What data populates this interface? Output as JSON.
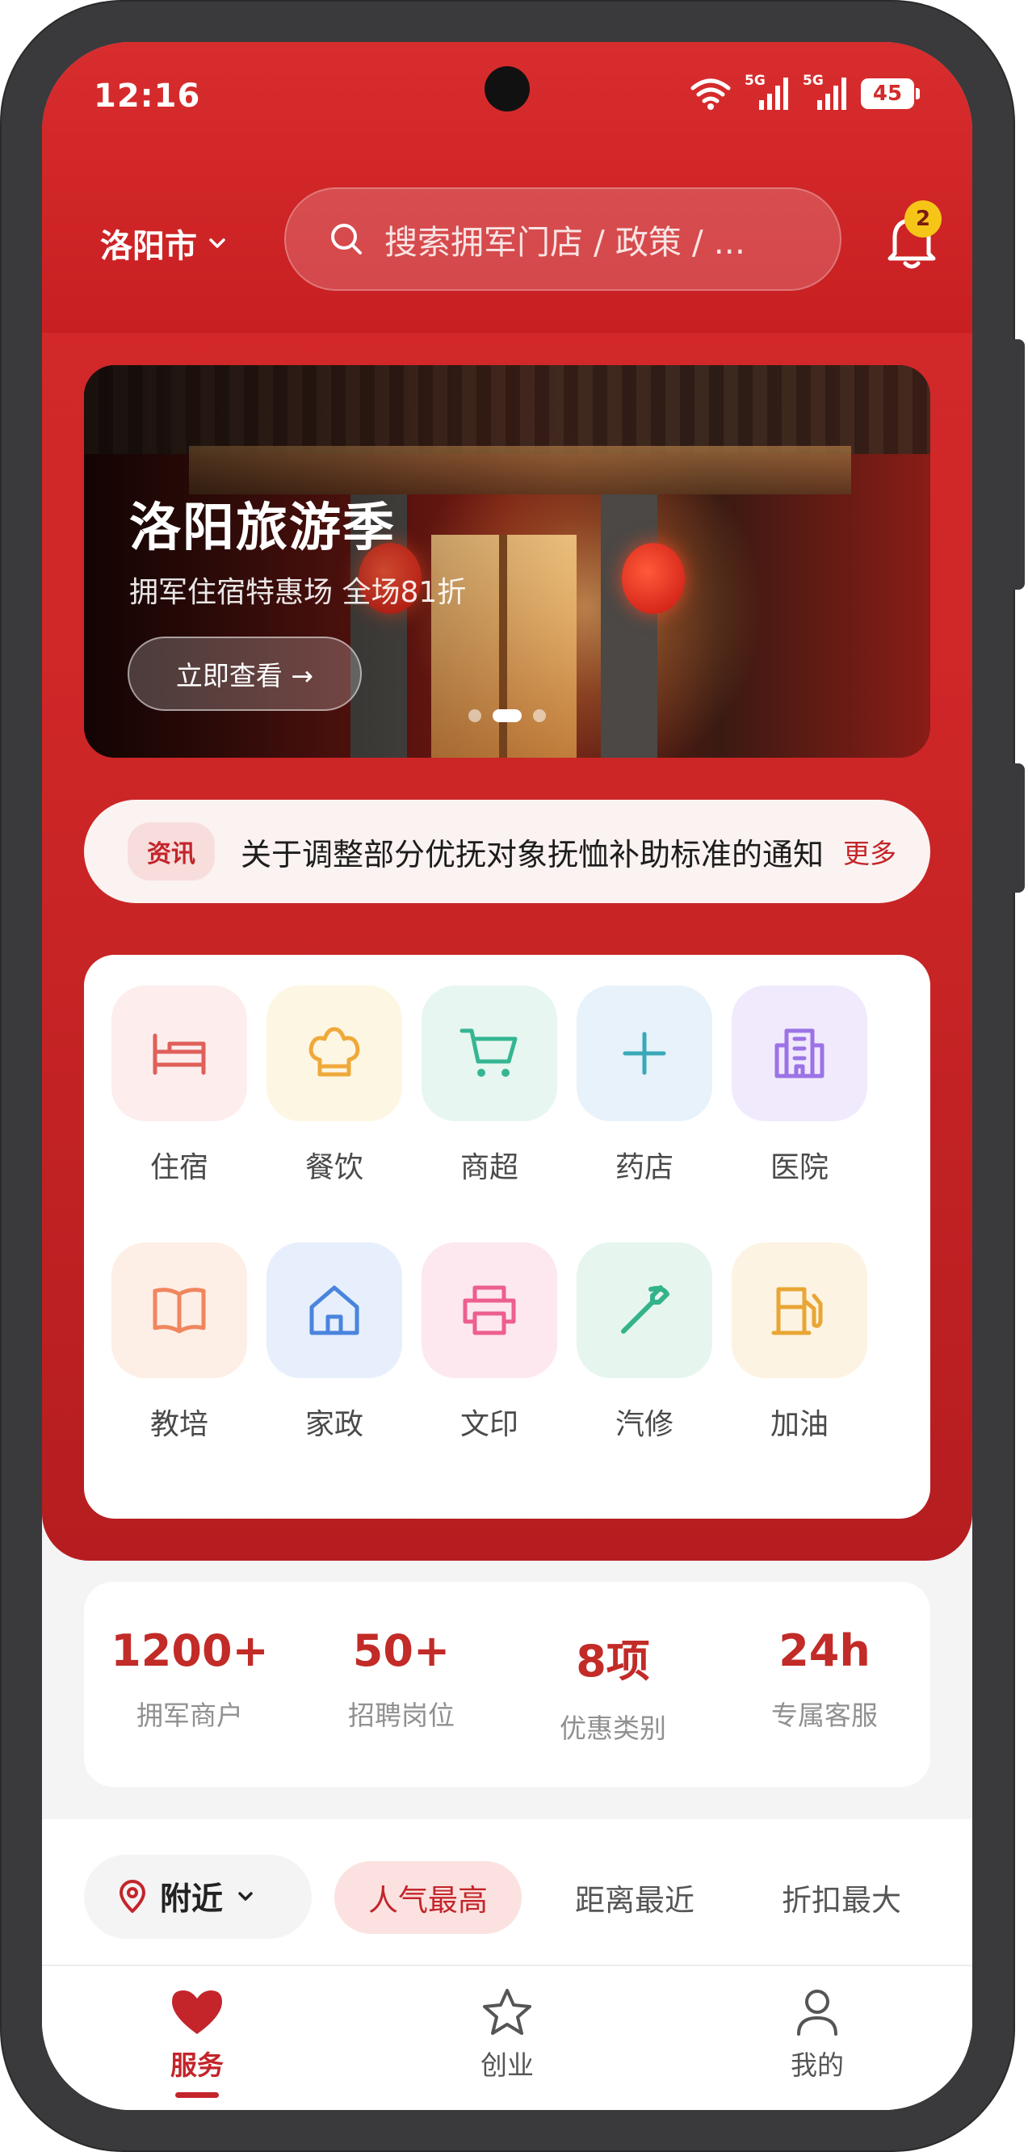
{
  "status_bar": {
    "time": "12:16",
    "net1": "5G",
    "net2": "5G",
    "battery": "45"
  },
  "header": {
    "city": "洛阳市",
    "search_placeholder": "搜索拥军门店 / 政策 / ...",
    "notification_count": "2"
  },
  "banner": {
    "title": "洛阳旅游季",
    "subtitle": "拥军住宿特惠场 全场81折",
    "button_label": "立即查看 →"
  },
  "news": {
    "tag": "资讯",
    "text": "关于调整部分优抚对象抚恤补助标准的通知",
    "more_label": "更多"
  },
  "categories": [
    {
      "label": "住宿",
      "icon": "bed-icon",
      "color": "#e0605a",
      "bg": "#fdeeed"
    },
    {
      "label": "餐饮",
      "icon": "chef-hat-icon",
      "color": "#efa93a",
      "bg": "#fdf6e3"
    },
    {
      "label": "商超",
      "icon": "cart-icon",
      "color": "#36b592",
      "bg": "#e7f6f0"
    },
    {
      "label": "药店",
      "icon": "plus-icon",
      "color": "#39a9b7",
      "bg": "#e8f2fb"
    },
    {
      "label": "医院",
      "icon": "hospital-icon",
      "color": "#9b73e6",
      "bg": "#f1eafc"
    },
    {
      "label": "教培",
      "icon": "book-icon",
      "color": "#f0865e",
      "bg": "#fdefe6"
    },
    {
      "label": "家政",
      "icon": "home-icon",
      "color": "#4a84dd",
      "bg": "#e7effc"
    },
    {
      "label": "文印",
      "icon": "printer-icon",
      "color": "#ec5f8e",
      "bg": "#fde8ef"
    },
    {
      "label": "汽修",
      "icon": "wrench-icon",
      "color": "#34b38b",
      "bg": "#e6f6ef"
    },
    {
      "label": "加油",
      "icon": "fuel-icon",
      "color": "#e9a634",
      "bg": "#fdf3e2"
    }
  ],
  "stats": [
    {
      "value": "1200+",
      "label": "拥军商户"
    },
    {
      "value": "50+",
      "label": "招聘岗位"
    },
    {
      "value": "8项",
      "label": "优惠类别"
    },
    {
      "value": "24h",
      "label": "专属客服"
    }
  ],
  "filters": {
    "location": "附近",
    "options": [
      "人气最高",
      "距离最近",
      "折扣最大"
    ],
    "active": "人气最高"
  },
  "tabs": [
    {
      "label": "服务",
      "icon": "heart-icon",
      "active": true
    },
    {
      "label": "创业",
      "icon": "star-icon",
      "active": false
    },
    {
      "label": "我的",
      "icon": "user-icon",
      "active": false
    }
  ],
  "colors": {
    "primary_red": "#d3282a",
    "accent_red": "#c3252b",
    "badge_yellow": "#f5c518"
  }
}
